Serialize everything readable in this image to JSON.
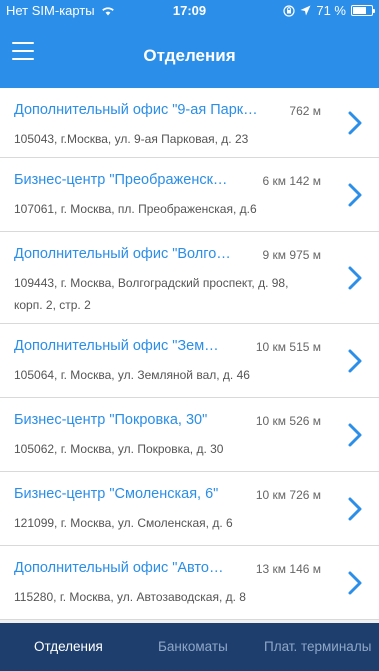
{
  "status_bar": {
    "carrier": "Нет SIM-карты",
    "time": "17:09",
    "battery": "71 %",
    "battery_level": 0.71
  },
  "header": {
    "title": "Отделения",
    "menu_icon": "hamburger-menu-icon"
  },
  "branches": [
    {
      "name": "Дополнительный офис \"9-ая Парк…",
      "distance": "762 м",
      "address": "105043, г.Москва, ул. 9-ая Парковая, д. 23"
    },
    {
      "name": "Бизнес-центр \"Преображенск…",
      "distance": "6 км 142 м",
      "address": "107061, г. Москва, пл. Преображенская, д.6"
    },
    {
      "name": "Дополнительный офис \"Волго…",
      "distance": "9 км 975 м",
      "address": "109443, г. Москва, Волгоградский проспект, д. 98, корп. 2, стр. 2"
    },
    {
      "name": "Дополнительный офис \"Зем…",
      "distance": "10 км 515 м",
      "address": "105064, г. Москва, ул. Земляной вал, д. 46"
    },
    {
      "name": "Бизнес-центр \"Покровка, 30\"",
      "distance": "10 км 526 м",
      "address": "105062, г. Москва, ул. Покровка, д. 30"
    },
    {
      "name": "Бизнес-центр \"Смоленская, 6\"",
      "distance": "10 км 726 м",
      "address": "121099, г. Москва, ул. Смоленская, д. 6"
    },
    {
      "name": "Дополнительный офис \"Авто…",
      "distance": "13 км 146 м",
      "address": "115280, г. Москва, ул. Автозаводская, д. 8"
    }
  ],
  "tabs": [
    {
      "label": "Отделения",
      "active": true
    },
    {
      "label": "Банкоматы",
      "active": false
    },
    {
      "label": "Плат. терминалы",
      "active": false
    }
  ],
  "colors": {
    "primary": "#2b8ee8",
    "tab_bar": "#1e3f6e",
    "link_text": "#2b8ee8"
  }
}
